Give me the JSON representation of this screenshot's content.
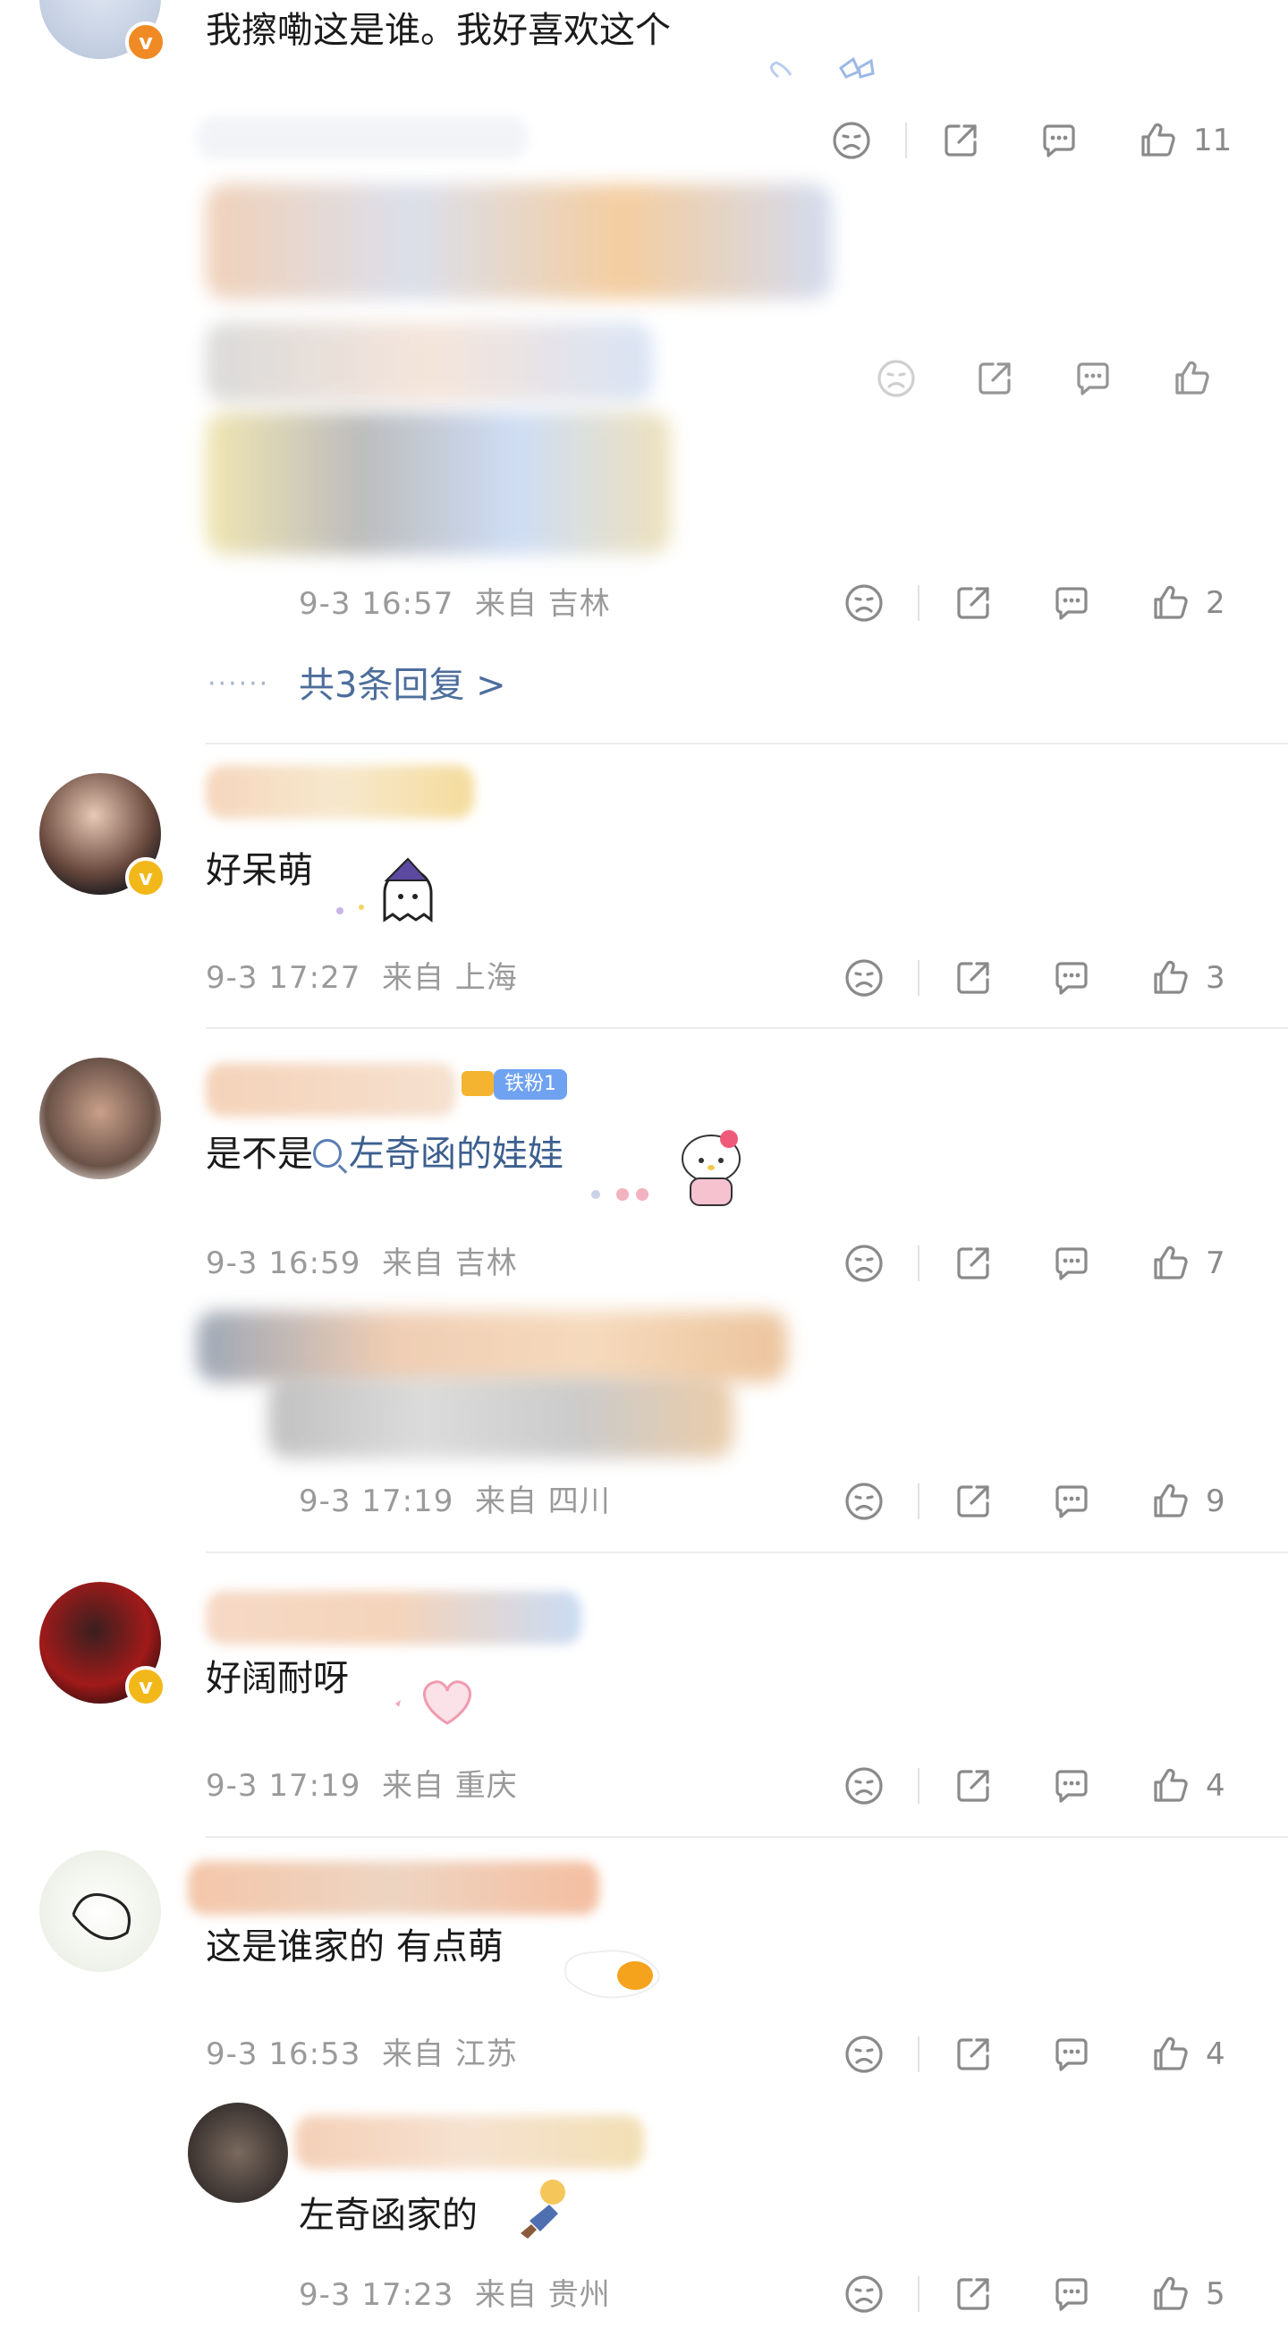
{
  "icons": {
    "dislike": "sad-face-icon",
    "share": "share-icon",
    "comment": "comment-icon",
    "like": "thumbs-up-icon"
  },
  "comments": [
    {
      "text": "我擦嘞这是谁。我好喜欢这个",
      "likes": "11"
    },
    {
      "likes": "",
      "time": "9-3 16:57",
      "location": "来自 吉林",
      "likes2": "2"
    },
    {
      "text": "好呆萌",
      "time": "9-3 17:27",
      "location": "来自 上海",
      "likes": "3"
    },
    {
      "text_prefix": "是不是",
      "text_link": "左奇函的娃娃",
      "fan_badge": "铁粉1",
      "time": "9-3 16:59",
      "location": "来自 吉林",
      "likes": "7"
    },
    {
      "time": "9-3 17:19",
      "location": "来自 四川",
      "likes": "9"
    },
    {
      "text": "好阔耐呀",
      "time": "9-3 17:19",
      "location": "来自 重庆",
      "likes": "4"
    },
    {
      "text": "这是谁家的 有点萌",
      "time": "9-3 16:53",
      "location": "来自 江苏",
      "likes": "4"
    },
    {
      "text": "左奇函家的",
      "time": "9-3 17:23",
      "location": "来自 贵州",
      "likes": "5"
    }
  ],
  "replies_link": {
    "dots": "······",
    "label": "共3条回复 >"
  },
  "colors": {
    "link": "#3d5f8f",
    "meta": "#9a9a9a",
    "vip_orange": "#f08a24",
    "vip_gold": "#f2b81a"
  }
}
